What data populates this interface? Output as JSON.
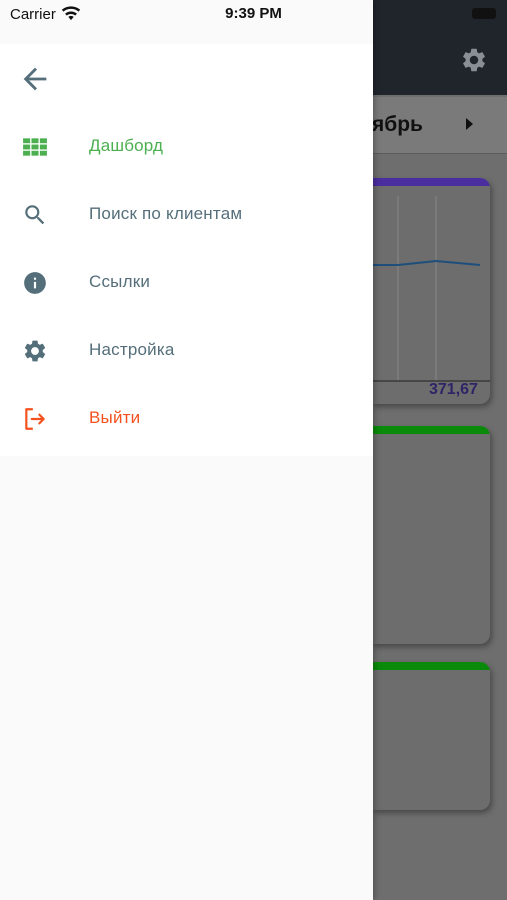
{
  "status_bar": {
    "carrier": "Carrier",
    "time": "9:39 PM"
  },
  "drawer": {
    "items": [
      {
        "label": "Дашборд",
        "icon": "dashboard-grid-icon",
        "active": true,
        "color": "#4caf50"
      },
      {
        "label": "Поиск по клиентам",
        "icon": "search-icon",
        "color": "#546e7a"
      },
      {
        "label": "Ссылки",
        "icon": "info-icon",
        "color": "#546e7a"
      },
      {
        "label": "Настройка",
        "icon": "gear-icon",
        "color": "#546e7a"
      },
      {
        "label": "Выйти",
        "icon": "logout-icon",
        "color": "#f4511e"
      }
    ]
  },
  "background": {
    "month_partial": "ябрь",
    "card1": {
      "value": "371,67",
      "accent": "#4a2ea0"
    },
    "card2": {
      "accent": "#0a8a0a"
    },
    "card3": {
      "accent": "#0a8a0a"
    }
  }
}
